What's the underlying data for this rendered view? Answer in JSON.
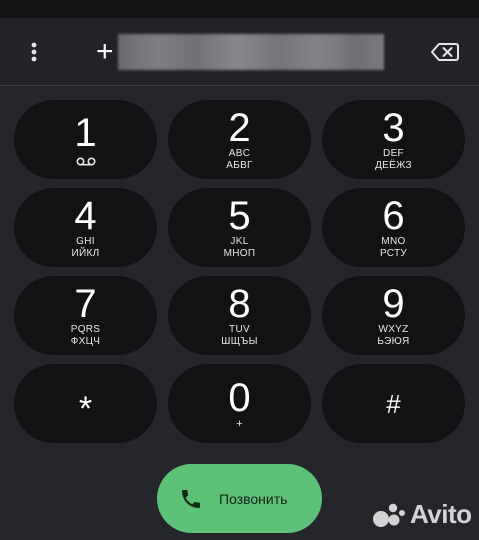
{
  "dialer": {
    "prefix": "+",
    "number_value": "",
    "keys": [
      {
        "digit": "1",
        "latin": "",
        "cyr": "",
        "icon": "voicemail-icon"
      },
      {
        "digit": "2",
        "latin": "ABC",
        "cyr": "АБВГ"
      },
      {
        "digit": "3",
        "latin": "DEF",
        "cyr": "ДЕЁЖЗ"
      },
      {
        "digit": "4",
        "latin": "GHI",
        "cyr": "ИЙКЛ"
      },
      {
        "digit": "5",
        "latin": "JKL",
        "cyr": "МНОП"
      },
      {
        "digit": "6",
        "latin": "MNO",
        "cyr": "РСТУ"
      },
      {
        "digit": "7",
        "latin": "PQRS",
        "cyr": "ФХЦЧ"
      },
      {
        "digit": "8",
        "latin": "TUV",
        "cyr": "ШЩЪЫ"
      },
      {
        "digit": "9",
        "latin": "WXYZ",
        "cyr": "ЬЭЮЯ"
      },
      {
        "digit": "*",
        "latin": "",
        "cyr": ""
      },
      {
        "digit": "0",
        "latin": "+",
        "cyr": ""
      },
      {
        "digit": "#",
        "latin": "",
        "cyr": ""
      }
    ],
    "call_label": "Позвонить"
  },
  "icons": {
    "menu": "more-vert-icon",
    "backspace": "backspace-icon",
    "call": "phone-icon"
  },
  "colors": {
    "background": "#24262b",
    "key": "#111214",
    "call_button": "#5ec178"
  },
  "watermark": {
    "text": "Avito"
  }
}
